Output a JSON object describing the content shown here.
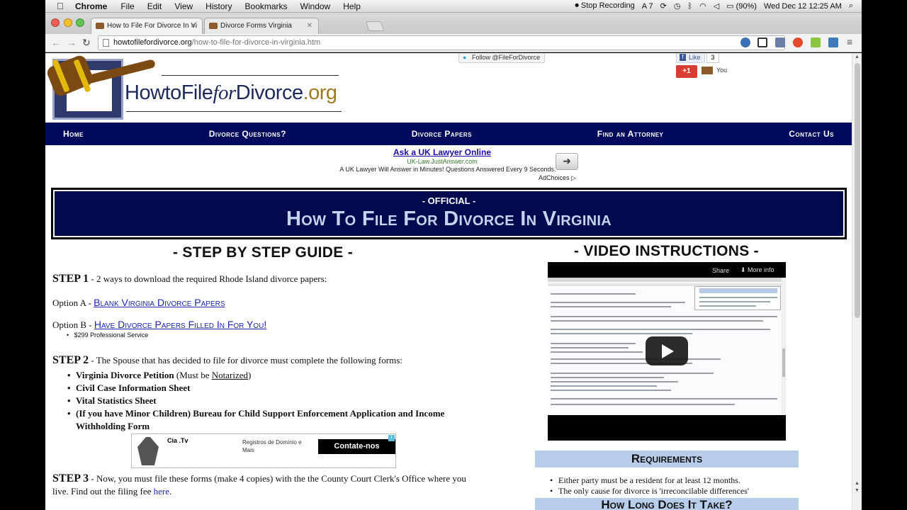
{
  "menubar": {
    "apple": "",
    "app": "Chrome",
    "items": [
      "File",
      "Edit",
      "View",
      "History",
      "Bookmarks",
      "Window",
      "Help"
    ],
    "status": {
      "recording": "Stop Recording",
      "badge": "7",
      "battery": "(90%)",
      "datetime": "Wed Dec 12  12:25 AM"
    }
  },
  "browser": {
    "tabs": [
      {
        "title": "How to File For Divorce In Vi",
        "active": true
      },
      {
        "title": "Divorce Forms Virginia",
        "active": false
      }
    ],
    "url_domain": "howtofilefordivorce.org",
    "url_path": "/how-to-file-for-divorce-in-virginia.htm"
  },
  "colors": {
    "navy": "#000a5c",
    "banner_title": "#c4d3ee",
    "link": "#1a27b0",
    "requirements_bg": "#b7cdea"
  },
  "site": {
    "logo": {
      "brand_a": "Howto",
      "brand_b": "File",
      "brand_c": "for",
      "brand_d": "Divorce",
      "brand_e": ".org"
    },
    "twitter": "Follow @FileForDivorce",
    "fb_like": "Like",
    "fb_count": "3",
    "gplus": "+1",
    "gplus_you": "You",
    "nav": [
      "Home",
      "Divorce Questions?",
      "Divorce Papers",
      "Find an Attorney",
      "Contact Us"
    ]
  },
  "ad1": {
    "title": "Ask a UK Lawyer Online",
    "url": "UK-Law.JustAnswer.com",
    "desc": "A UK Lawyer Will Answer in Minutes! Questions Answered Every 9 Seconds.",
    "choices": "AdChoices ▷"
  },
  "banner": {
    "official": "- OFFICIAL -",
    "title": "How To File For Divorce In Virginia"
  },
  "guide": {
    "heading": "- STEP BY STEP GUIDE -",
    "step1_label": "STEP 1",
    "step1_text": " - 2 ways to download the required Rhode Island divorce papers:",
    "optionA_label": "Option A - ",
    "optionA_link": "Blank Virginia Divorce Papers",
    "optionB_label": "Option B - ",
    "optionB_link": "Have Divorce Papers Filled In For You!",
    "optionB_price": "$299 Professional Service",
    "step2_label": "STEP 2",
    "step2_text": " - The Spouse that has decided to file for divorce must complete the following forms:",
    "forms": {
      "f1": "Virginia Divorce Petition",
      "f1_note_a": " (Must be ",
      "f1_note_b": "Notarized",
      "f1_note_c": ")",
      "f2": "Civil Case Information Sheet",
      "f3": "Vital Statistics Sheet",
      "f4": "(If you have Minor Children) Bureau for Child Support Enforcement Application and Income Withholding Form"
    },
    "step3_label": "STEP 3",
    "step3_text": " - Now, you must file these forms (make 4 copies) with the the County Court Clerk's Office where you live. Find out the filing fee ",
    "step3_link": "here",
    "step3_end": "."
  },
  "ad2": {
    "brand": "Cia .Tv",
    "desc": "Registros de Domínio e Mais",
    "button": "Contate-nos"
  },
  "video": {
    "heading": "- VIDEO INSTRUCTIONS -",
    "share": "Share",
    "more": "More info"
  },
  "requirements": {
    "heading": "Requirements",
    "items": [
      "Either party must be a resident for at least 12 months.",
      "The only cause for divorce is 'irreconcilable differences'"
    ],
    "next_heading": "How Long Does It Take?"
  }
}
